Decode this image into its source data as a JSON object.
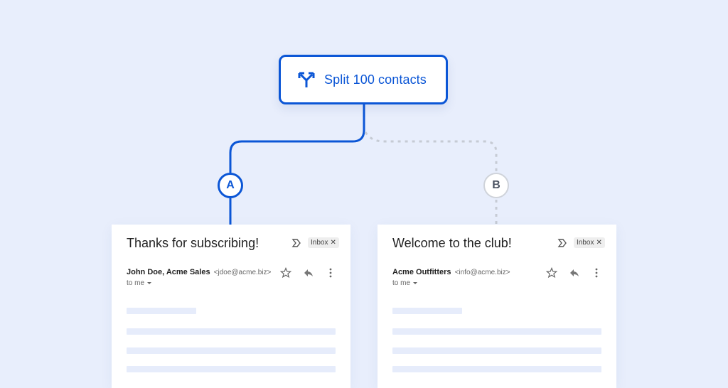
{
  "split_node": {
    "label": "Split 100 contacts",
    "icon": "split-arrows-icon"
  },
  "branches": [
    {
      "badge": "A",
      "active": true
    },
    {
      "badge": "B",
      "active": false
    }
  ],
  "emails": [
    {
      "subject": "Thanks for subscribing!",
      "label_chip": "Inbox",
      "sender_name": "John Doe, Acme Sales",
      "sender_email": "<jdoe@acme.biz>",
      "recipient": "to me"
    },
    {
      "subject": "Welcome to the club!",
      "label_chip": "Inbox",
      "sender_name": "Acme Outfitters",
      "sender_email": "<info@acme.biz>",
      "recipient": "to me"
    }
  ],
  "colors": {
    "accent": "#0b56d6",
    "background": "#e8eefc",
    "inactive_line": "#c6cbd4",
    "placeholder": "#e6ecfb"
  }
}
